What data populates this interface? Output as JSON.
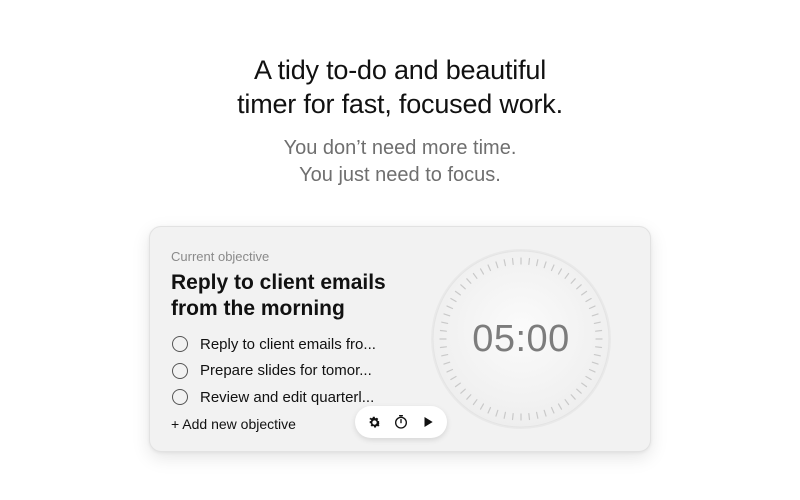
{
  "hero": {
    "title_line1": "A tidy to-do and beautiful",
    "title_line2": "timer for fast, focused work.",
    "subtitle_line1": "You don’t need more time.",
    "subtitle_line2": "You just need to focus."
  },
  "card": {
    "label": "Current objective",
    "title_line1": "Reply to client emails",
    "title_line2": "from the morning",
    "tasks": [
      {
        "label": "Reply to client emails fro...",
        "checked": false
      },
      {
        "label": "Prepare slides for tomor...",
        "checked": false
      },
      {
        "label": "Review and edit quarterl...",
        "checked": false
      }
    ],
    "add_label": "+ Add new objective"
  },
  "toolbar": {
    "icons": [
      "gear-icon",
      "timer-icon",
      "play-icon"
    ]
  },
  "timer": {
    "display": "05:00"
  },
  "colors": {
    "background": "#ffffff",
    "card": "#f2f2f2",
    "subtitle": "#6f6f6f",
    "timer_text": "#7c7c7c"
  }
}
